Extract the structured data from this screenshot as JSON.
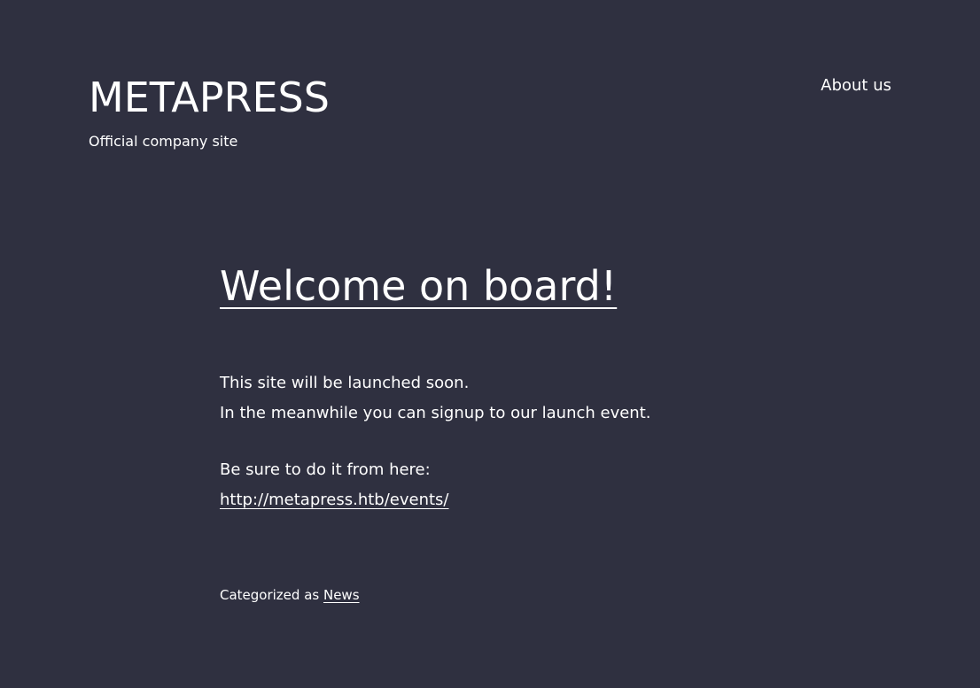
{
  "header": {
    "site_title": "METAPRESS",
    "tagline": "Official company site",
    "nav": {
      "about_label": "About us"
    }
  },
  "post": {
    "title": "Welcome on board!",
    "content": {
      "line1": "This site will be launched soon.",
      "line2": "In the meanwhile you can signup to our launch event.",
      "line3": "Be sure to do it from here:",
      "link": "http://metapress.htb/events/"
    },
    "meta": {
      "categorized_prefix": "Categorized as",
      "category": "News"
    }
  },
  "colors": {
    "background": "#2f3040",
    "text": "#ffffff"
  }
}
